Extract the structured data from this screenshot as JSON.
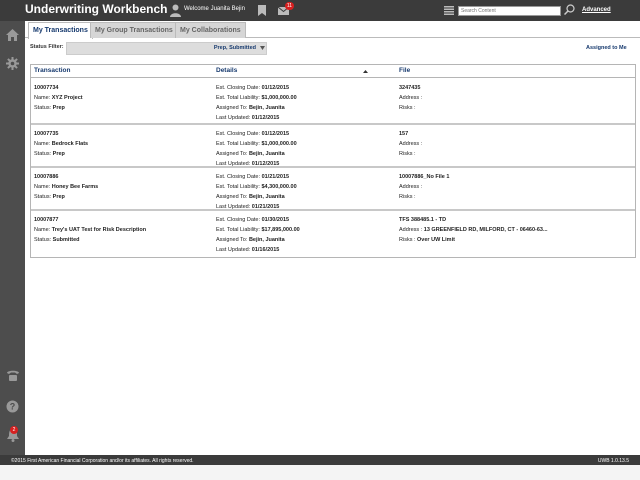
{
  "app": {
    "title": "Underwriting Workbench",
    "welcome": "Welcome Juanita Bejin",
    "mail_count": "11",
    "search_placeholder": "Search Content",
    "advanced_label": "Advanced",
    "notification_count": "2"
  },
  "tabs": [
    {
      "label": "My Transactions",
      "active": true
    },
    {
      "label": "My Group Transactions",
      "active": false
    },
    {
      "label": "My Collaborations",
      "active": false
    }
  ],
  "filter": {
    "label": "Status Filter:",
    "value": "Prep, Submitted",
    "assigned_link": "Assigned to Me"
  },
  "table": {
    "headers": {
      "transaction": "Transaction",
      "details": "Details",
      "file": "File"
    },
    "rows": [
      {
        "id": "10007734",
        "name": "XYZ Project",
        "status": "Prep",
        "closing": "01/12/2015",
        "liability": "$1,000,000.00",
        "assigned": "Bejin, Juanita",
        "updated": "01/12/2015",
        "file": "3247435",
        "address": "",
        "risks": ""
      },
      {
        "id": "10007735",
        "name": "Bedrock Flats",
        "status": "Prep",
        "closing": "01/12/2015",
        "liability": "$1,000,000.00",
        "assigned": "Bejin, Juanita",
        "updated": "01/12/2015",
        "file": "157",
        "address": "",
        "risks": ""
      },
      {
        "id": "10007886",
        "name": "Honey Bee Farms",
        "status": "Prep",
        "closing": "01/21/2015",
        "liability": "$4,300,000.00",
        "assigned": "Bejin, Juanita",
        "updated": "01/21/2015",
        "file": "10007886_No File 1",
        "address": "",
        "risks": ""
      },
      {
        "id": "10007877",
        "name": "Trey's UAT Test for Risk Description",
        "status": "Submitted",
        "closing": "01/30/2015",
        "liability": "$17,895,000.00",
        "assigned": "Bejin, Juanita",
        "updated": "01/16/2015",
        "file": "TFS 388485.1 - TD",
        "address": "13 GREENFIELD RD, MILFORD, CT - 06460-63...",
        "risks": "Over UW Limit"
      }
    ],
    "field_labels": {
      "name": "Name:",
      "status": "Status:",
      "closing": "Est. Closing Date:",
      "liability": "Est. Total Liability:",
      "assigned": "Assigned To:",
      "updated": "Last Updated:",
      "address": "Address :",
      "risks": "Risks :"
    }
  },
  "footer": {
    "copyright": "©2015 First American Financial Corporation and/or its affiliates. All rights reserved.",
    "version": "UWB 1.0.13.5"
  }
}
